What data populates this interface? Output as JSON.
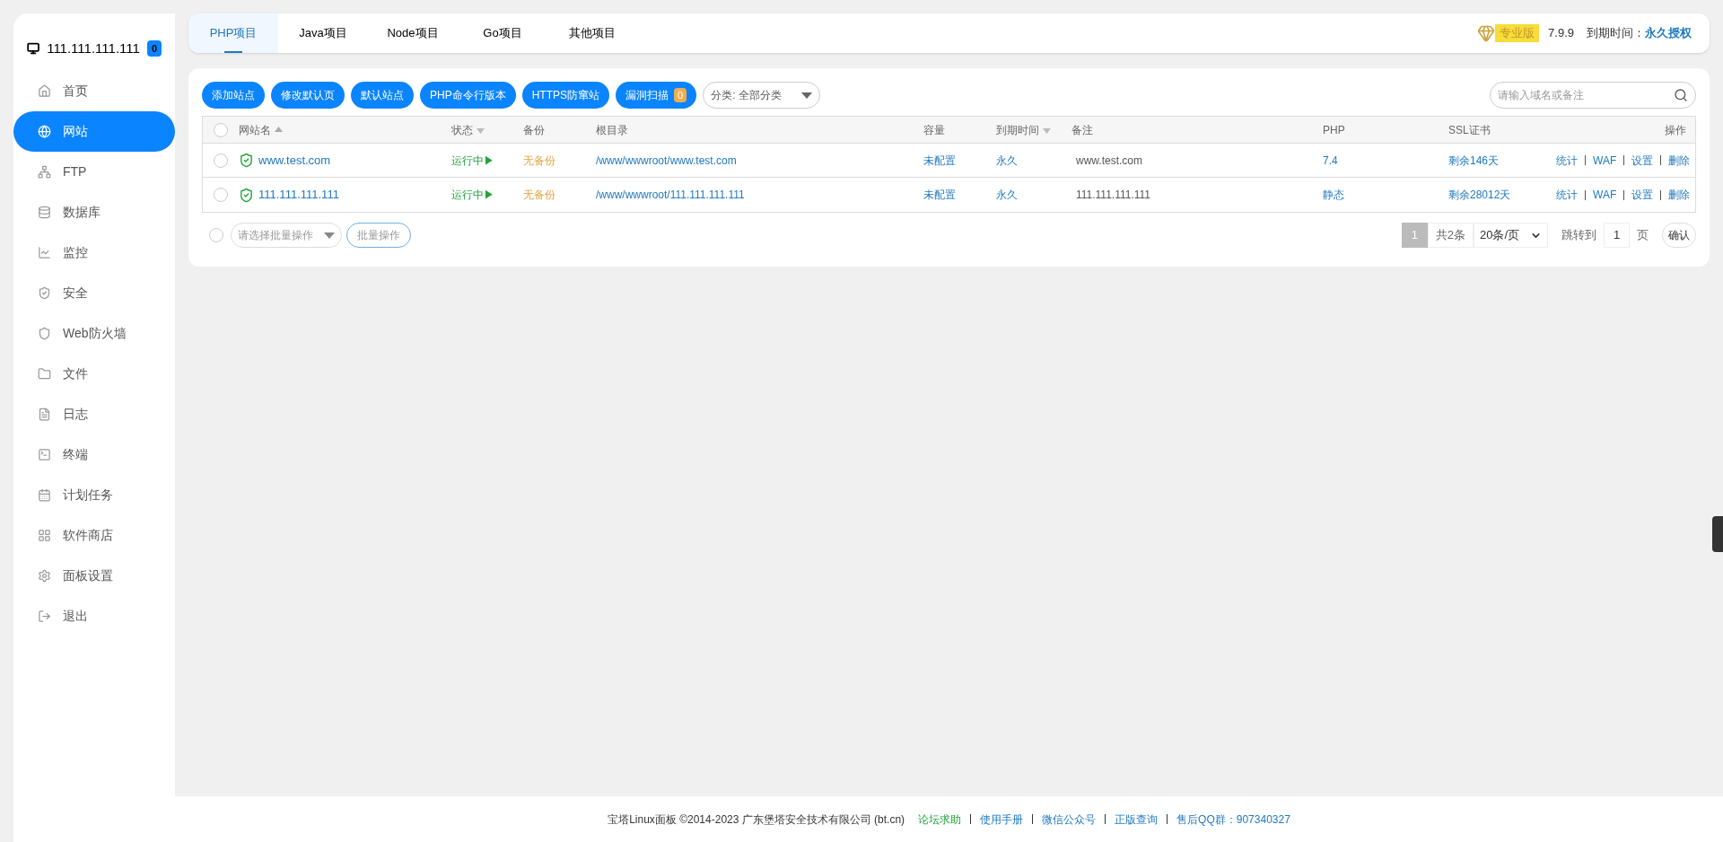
{
  "sidebar": {
    "host": "111.111.111.111",
    "badge": "0",
    "items": [
      {
        "label": "首页",
        "kind": "home",
        "selected": false
      },
      {
        "label": "网站",
        "kind": "globe",
        "selected": true
      },
      {
        "label": "FTP",
        "kind": "ftp",
        "selected": false
      },
      {
        "label": "数据库",
        "kind": "database",
        "selected": false
      },
      {
        "label": "监控",
        "kind": "monitor",
        "selected": false
      },
      {
        "label": "安全",
        "kind": "shield",
        "selected": false
      },
      {
        "label": "Web防火墙",
        "kind": "firewall",
        "selected": false
      },
      {
        "label": "文件",
        "kind": "folder",
        "selected": false
      },
      {
        "label": "日志",
        "kind": "log",
        "selected": false
      },
      {
        "label": "终端",
        "kind": "terminal",
        "selected": false
      },
      {
        "label": "计划任务",
        "kind": "calendar",
        "selected": false
      },
      {
        "label": "软件商店",
        "kind": "grid",
        "selected": false
      },
      {
        "label": "面板设置",
        "kind": "settings",
        "selected": false
      },
      {
        "label": "退出",
        "kind": "logout",
        "selected": false
      }
    ]
  },
  "tabs": [
    {
      "label": "PHP项目",
      "selected": true
    },
    {
      "label": "Java项目",
      "selected": false
    },
    {
      "label": "Node项目",
      "selected": false
    },
    {
      "label": "Go项目",
      "selected": false
    },
    {
      "label": "其他项目",
      "selected": false
    }
  ],
  "header": {
    "edition": "专业版",
    "version": "7.9.9",
    "expiry_label": "到期时间：",
    "expiry_value": "永久授权"
  },
  "toolbar": {
    "buttons": [
      {
        "label": "添加站点"
      },
      {
        "label": "修改默认页"
      },
      {
        "label": "默认站点"
      },
      {
        "label": "PHP命令行版本"
      },
      {
        "label": "HTTPS防窜站"
      },
      {
        "label": "漏洞扫描",
        "count": "0"
      }
    ],
    "category": "分类: 全部分类",
    "search": {
      "placeholder": "请输入域名或备注"
    }
  },
  "table": {
    "all_checked": false,
    "columns": [
      {
        "label": "网站名",
        "ascending": true
      },
      {
        "label": "状态",
        "ascending": false
      },
      {
        "label": "备份"
      },
      {
        "label": "根目录"
      },
      {
        "label": "容量"
      },
      {
        "label": "到期时间",
        "ascending": false
      },
      {
        "label": "备注"
      },
      {
        "label": "PHP"
      },
      {
        "label": "SSL证书"
      },
      {
        "label": "操作"
      }
    ],
    "rows": [
      {
        "checked": false,
        "name": "www.test.com",
        "status": "运行中▶",
        "backup": "无备份",
        "root": "/www/wwwroot/www.test.com",
        "quota": "未配置",
        "expiry": "永久",
        "note": "www.test.com",
        "php": "7.4",
        "ssl": "剩余146天",
        "actions": [
          "统计",
          "WAF",
          "设置",
          "删除"
        ]
      },
      {
        "checked": false,
        "name": "111.111.111.111",
        "status": "运行中▶",
        "backup": "无备份",
        "root": "/www/wwwroot/111.111.111.111",
        "quota": "未配置",
        "expiry": "永久",
        "note": "111.111.111.111",
        "php": "静态",
        "ssl": "剩余28012天",
        "actions": [
          "统计",
          "WAF",
          "设置",
          "删除"
        ]
      }
    ]
  },
  "batch": {
    "checked": false,
    "placeholder": "请选择批量操作",
    "button": "批量操作"
  },
  "pagination": {
    "current": "1",
    "total": "共2条",
    "page_size": "20条/页",
    "jump_label": "跳转到",
    "jump_value": "1",
    "unit": "页",
    "confirm": "确认"
  },
  "footer": {
    "copyright": "宝塔Linux面板 ©2014-2023 广东堡塔安全技术有限公司 (bt.cn)",
    "links": [
      {
        "label": "论坛求助",
        "highlighted": true
      },
      {
        "label": "使用手册",
        "highlighted": false
      },
      {
        "label": "微信公众号",
        "highlighted": false
      },
      {
        "label": "正版查询",
        "highlighted": false
      },
      {
        "label": "售后QQ群：907340327",
        "highlighted": false
      }
    ]
  }
}
